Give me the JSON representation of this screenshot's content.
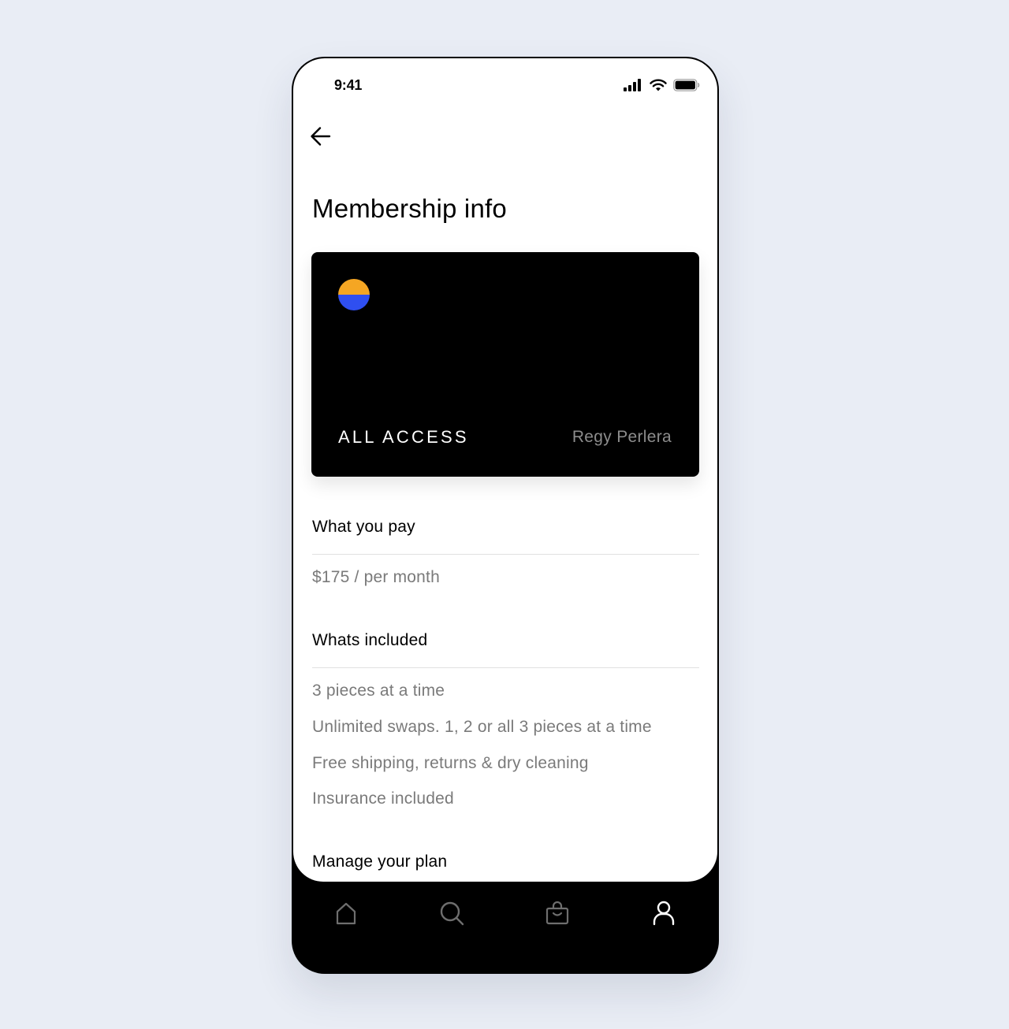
{
  "status_bar": {
    "time": "9:41"
  },
  "header": {
    "back_icon": "arrow-left-icon",
    "title": "Membership info"
  },
  "card": {
    "tier": "ALL ACCESS",
    "holder_name": "Regy Perlera",
    "logo_colors": {
      "top": "#f5a623",
      "bottom": "#2f4ff0"
    },
    "background": "#000000"
  },
  "sections": {
    "pay": {
      "heading": "What you pay",
      "price": "$175 / per month"
    },
    "included": {
      "heading": "Whats included",
      "items": [
        "3 pieces at a time",
        "Unlimited swaps. 1, 2 or all 3 pieces at a time",
        "Free shipping, returns & dry cleaning",
        "Insurance included"
      ]
    },
    "manage": {
      "heading": "Manage your plan"
    }
  },
  "tabbar": {
    "items": [
      {
        "icon": "home-icon",
        "active": false
      },
      {
        "icon": "search-icon",
        "active": false
      },
      {
        "icon": "bag-icon",
        "active": false
      },
      {
        "icon": "profile-icon",
        "active": true
      }
    ],
    "active_color": "#ffffff",
    "inactive_color": "#6e6e6e"
  }
}
